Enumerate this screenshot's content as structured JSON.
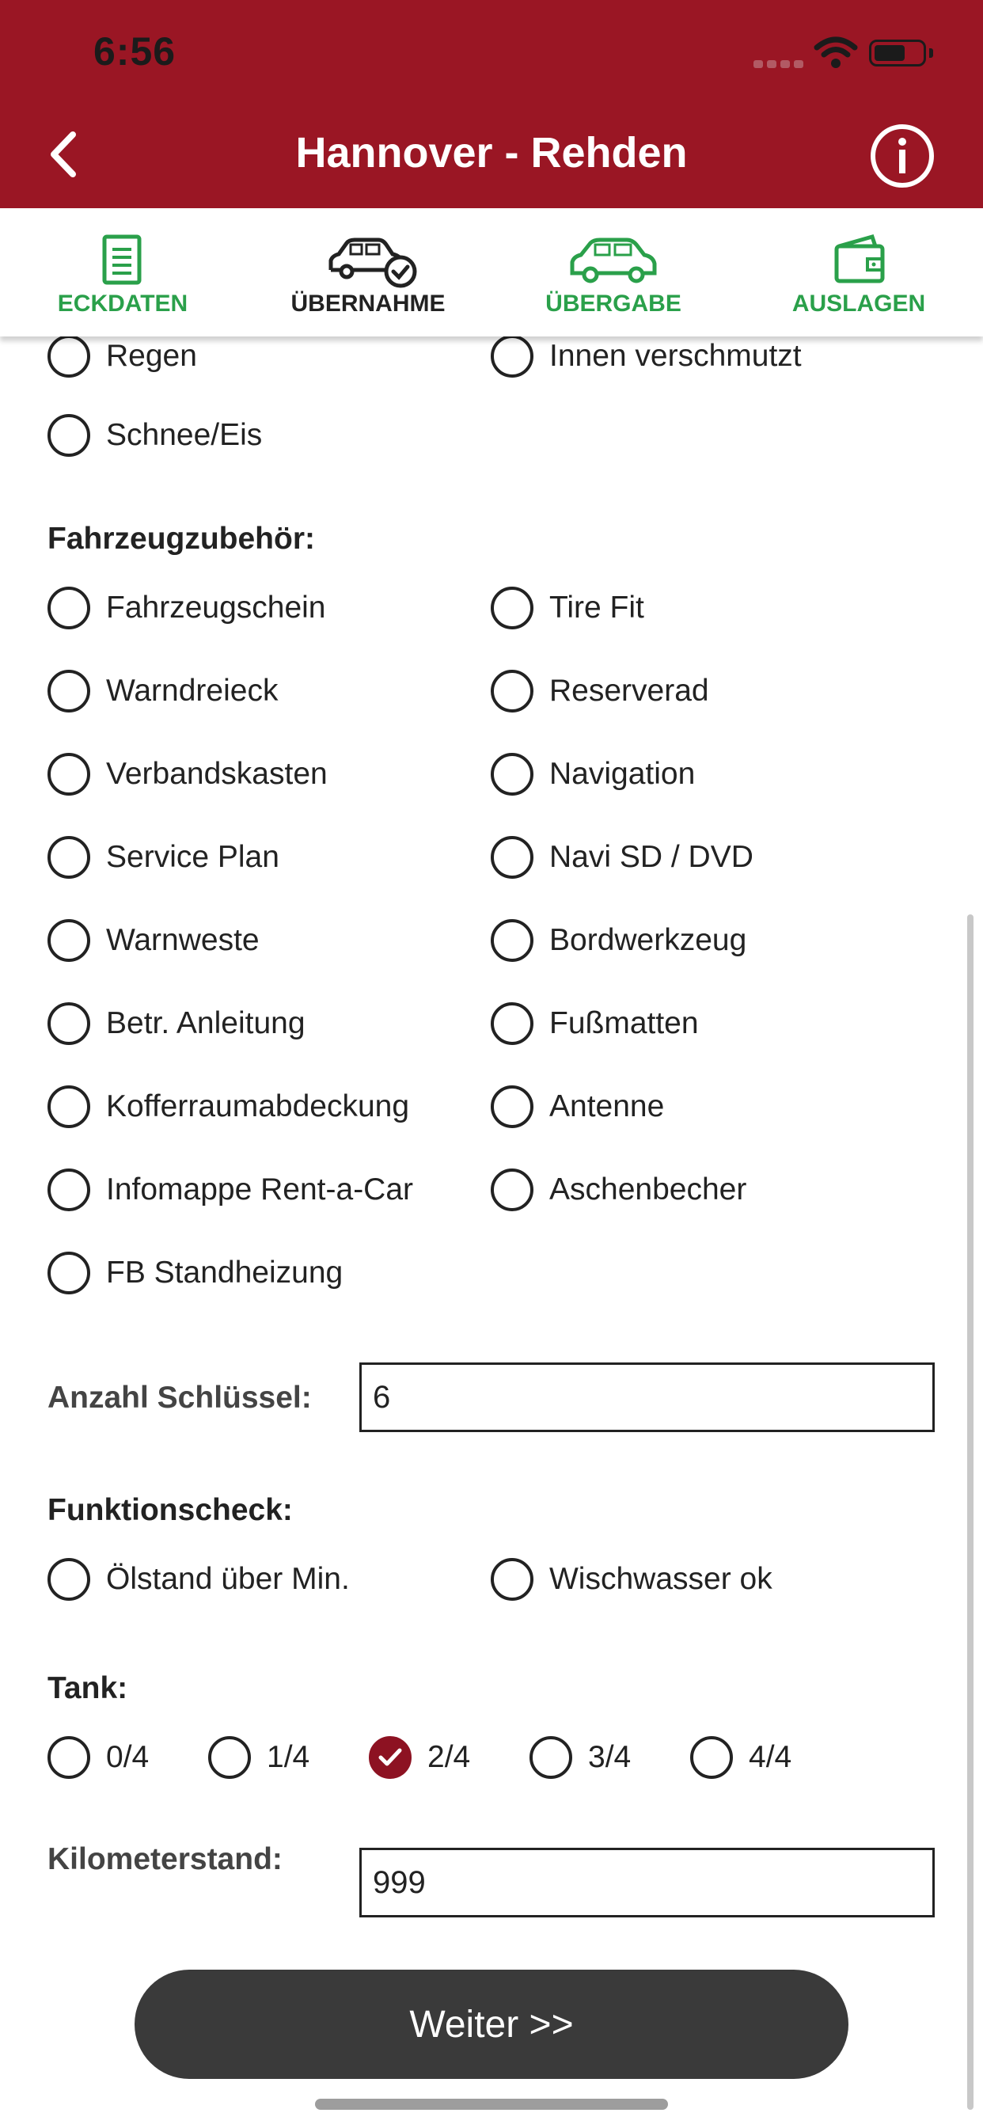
{
  "status_bar": {
    "time": "6:56"
  },
  "header": {
    "title": "Hannover - Rehden"
  },
  "tabs": [
    {
      "label": "ECKDATEN",
      "icon": "document-icon",
      "color": "#2aa04a"
    },
    {
      "label": "ÜBERNAHME",
      "icon": "car-check-icon",
      "color": "#222222"
    },
    {
      "label": "ÜBERGABE",
      "icon": "car-icon",
      "color": "#2aa04a"
    },
    {
      "label": "AUSLAGEN",
      "icon": "wallet-icon",
      "color": "#2aa04a"
    }
  ],
  "weather": {
    "items": [
      "Regen",
      "Innen verschmutzt",
      "Schnee/Eis"
    ]
  },
  "accessories": {
    "title": "Fahrzeugzubehör:",
    "items": [
      "Fahrzeugschein",
      "Tire Fit",
      "Warndreieck",
      "Reserverad",
      "Verbandskasten",
      "Navigation",
      "Service Plan",
      "Navi SD / DVD",
      "Warnweste",
      "Bordwerkzeug",
      "Betr. Anleitung",
      "Fußmatten",
      "Kofferraumabdeckung",
      "Antenne",
      "Infomappe Rent-a-Car",
      "Aschenbecher",
      "FB Standheizung"
    ]
  },
  "keys": {
    "label": "Anzahl Schlüssel:",
    "value": "6"
  },
  "function_check": {
    "title": "Funktionscheck:",
    "items": [
      "Ölstand über Min.",
      "Wischwasser ok"
    ]
  },
  "tank": {
    "title": "Tank:",
    "options": [
      "0/4",
      "1/4",
      "2/4",
      "3/4",
      "4/4"
    ],
    "selected": "2/4"
  },
  "mileage": {
    "label": "Kilometerstand:",
    "value": "999"
  },
  "next_button": {
    "label": "Weiter >>"
  },
  "colors": {
    "header": "#9a1624",
    "accent_green": "#2aa04a",
    "checked": "#8d1222",
    "button": "#3a3a3a"
  }
}
